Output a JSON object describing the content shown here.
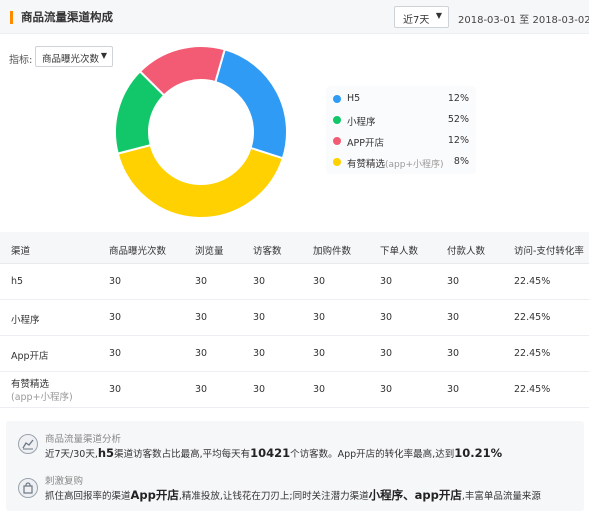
{
  "header": {
    "title": "商品流量渠道构成",
    "period": "近7天",
    "date_range": "2018-03-01 至 2018-03-02"
  },
  "metric": {
    "label": "指标:",
    "selected": "商品曝光次数"
  },
  "colors": {
    "h5": "#2f9bf4",
    "miniprogram": "#12c76a",
    "app": "#f35b74",
    "youzan": "#ffd100",
    "accent": "#ff8a00"
  },
  "chart_data": {
    "type": "pie",
    "categories": [
      "H5",
      "小程序",
      "APP开店",
      "有赞精选(app+小程序)"
    ],
    "values": [
      12,
      52,
      12,
      8
    ],
    "colors": [
      "#2f9bf4",
      "#ffd100",
      "#12c76a",
      "#f35b74"
    ],
    "note": "donut chart; visible slice order clockwise from top: H5 (blue), 小程序 (yellow), 有赞精选 (green), APP开店 (pink)"
  },
  "legend": [
    {
      "name": "H5",
      "sub": "",
      "value": "12%",
      "color": "#2f9bf4"
    },
    {
      "name": "小程序",
      "sub": "",
      "value": "52%",
      "color": "#12c76a"
    },
    {
      "name": "APP开店",
      "sub": "",
      "value": "12%",
      "color": "#f35b74"
    },
    {
      "name": "有赞精选",
      "sub": "(app+小程序)",
      "value": "8%",
      "color": "#ffd100"
    }
  ],
  "table": {
    "headers": [
      "渠道",
      "商品曝光次数",
      "浏览量",
      "访客数",
      "加购件数",
      "下单人数",
      "付款人数",
      "访问-支付转化率"
    ],
    "rows": [
      {
        "channel": "h5",
        "sub": "",
        "cells": [
          "30",
          "30",
          "30",
          "30",
          "30",
          "30",
          "22.45%"
        ]
      },
      {
        "channel": "小程序",
        "sub": "",
        "cells": [
          "30",
          "30",
          "30",
          "30",
          "30",
          "30",
          "22.45%"
        ]
      },
      {
        "channel": "App开店",
        "sub": "",
        "cells": [
          "30",
          "30",
          "30",
          "30",
          "30",
          "30",
          "22.45%"
        ]
      },
      {
        "channel": "有赞精选",
        "sub": "(app+小程序)",
        "cells": [
          "30",
          "30",
          "30",
          "30",
          "30",
          "30",
          "22.45%"
        ]
      }
    ]
  },
  "analysis": {
    "title": "商品流量渠道分析",
    "t1": "近7天/30天,",
    "b1": "h5",
    "t2": "渠道访客数占比最高,平均每天有",
    "b2": "10421",
    "t3": "个访客数。App开店的转化率最高,达到",
    "b3": "10.21%"
  },
  "stimulate": {
    "title": "刺激复购",
    "t1": "抓住高回报率的渠道",
    "b1": "App开店",
    "t2": ",精准投放,让钱花在刀刃上;同时关注潜力渠道",
    "b2": "小程序、app开店",
    "t3": ",丰富单品流量来源"
  },
  "icons": {
    "period_caret": "caret-down-icon",
    "metric_caret": "caret-down-icon",
    "analysis": "line-chart-icon",
    "stimulate": "shopping-bag-icon"
  }
}
